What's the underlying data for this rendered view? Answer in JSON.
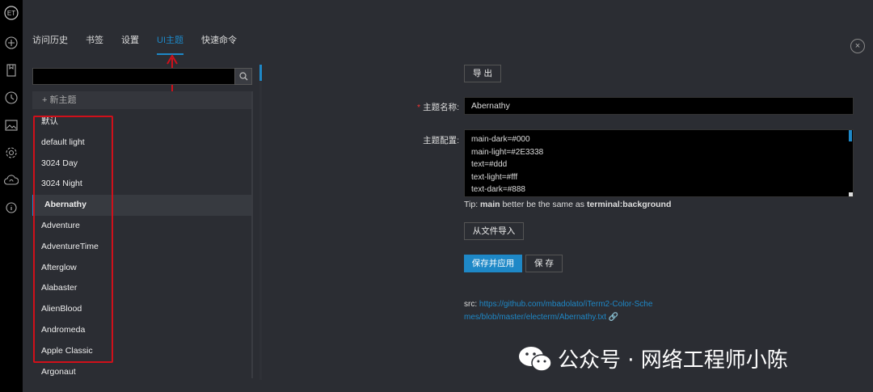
{
  "sidebar_rail": {
    "logo": "ET",
    "icons": [
      "plus-circle-icon",
      "bookmark-icon",
      "clock-icon",
      "image-icon",
      "gear-icon",
      "cloud-sync-icon",
      "info-icon"
    ]
  },
  "tabs": [
    {
      "label": "访问历史",
      "active": false
    },
    {
      "label": "书签",
      "active": false
    },
    {
      "label": "设置",
      "active": false
    },
    {
      "label": "UI主题",
      "active": true
    },
    {
      "label": "快速命令",
      "active": false
    }
  ],
  "close_label": "×",
  "search": {
    "value": "",
    "placeholder": ""
  },
  "new_theme_label": "+ 新主题",
  "themes": [
    {
      "label": "默认",
      "active": false
    },
    {
      "label": "default light",
      "active": false
    },
    {
      "label": "3024 Day",
      "active": false
    },
    {
      "label": "3024 Night",
      "active": false
    },
    {
      "label": "Abernathy",
      "active": true
    },
    {
      "label": "Adventure",
      "active": false
    },
    {
      "label": "AdventureTime",
      "active": false
    },
    {
      "label": "Afterglow",
      "active": false
    },
    {
      "label": "Alabaster",
      "active": false
    },
    {
      "label": "AlienBlood",
      "active": false
    },
    {
      "label": "Andromeda",
      "active": false
    },
    {
      "label": "Apple Classic",
      "active": false
    },
    {
      "label": "Argonaut",
      "active": false
    }
  ],
  "form": {
    "export_label": "导 出",
    "name_label": "主题名称:",
    "name_required_mark": "*",
    "name_value": "Abernathy",
    "config_label": "主题配置:",
    "config_lines": [
      "main-dark=#000",
      "main-light=#2E3338",
      "text=#ddd",
      "text-light=#fff",
      "text-dark=#888"
    ],
    "tip_prefix": "Tip: ",
    "tip_main": "main",
    "tip_mid": " better be the same as ",
    "tip_end": "terminal:background",
    "import_label": "从文件导入",
    "save_apply_label": "保存并应用",
    "save_label": "保 存",
    "src_label": "src: ",
    "src_link": "https://github.com/mbadolato/iTerm2-Color-Schemes/blob/master/electerm/Abernathy.txt"
  },
  "watermark": {
    "text": "公众号 · 网络工程师小陈"
  },
  "colors": {
    "accent": "#1e88c7",
    "highlight": "#d0101a",
    "background": "#2b2d33"
  }
}
